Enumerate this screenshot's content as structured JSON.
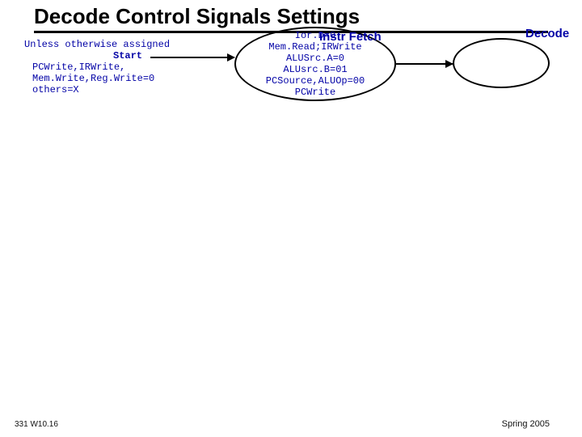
{
  "slide": {
    "title": "Decode Control Signals Settings",
    "footer_left": "331 W10.16",
    "footer_right": "Spring 2005"
  },
  "defaults": {
    "heading": "Unless otherwise assigned",
    "start_label": "Start",
    "lines": "PCWrite,IRWrite,\nMem.Write,Reg.Write=0\nothers=X"
  },
  "states": {
    "fetch": {
      "label": "Instr Fetch",
      "body": "Ior.D=0\nMem.Read;IRWrite\nALUSrc.A=0\nALUsrc.B=01\nPCSource,ALUOp=00\nPCWrite"
    },
    "decode": {
      "label": "Decode"
    }
  },
  "chart_data": {
    "type": "state-diagram",
    "title": "Decode Control Signals Settings",
    "defaults": {
      "PCWrite": 0,
      "IRWrite": 0,
      "MemWrite": 0,
      "RegWrite": 0,
      "others": "X"
    },
    "nodes": [
      {
        "id": "InstrFetch",
        "label": "Instr Fetch",
        "signals": {
          "IorD": 0,
          "MemRead": 1,
          "IRWrite": 1,
          "ALUSrcA": 0,
          "ALUSrcB": "01",
          "PCSource": "00",
          "ALUOp": "00",
          "PCWrite": 1
        }
      },
      {
        "id": "Decode",
        "label": "Decode",
        "signals": {}
      }
    ],
    "edges": [
      {
        "from": "Start",
        "to": "InstrFetch"
      },
      {
        "from": "InstrFetch",
        "to": "Decode"
      }
    ]
  }
}
